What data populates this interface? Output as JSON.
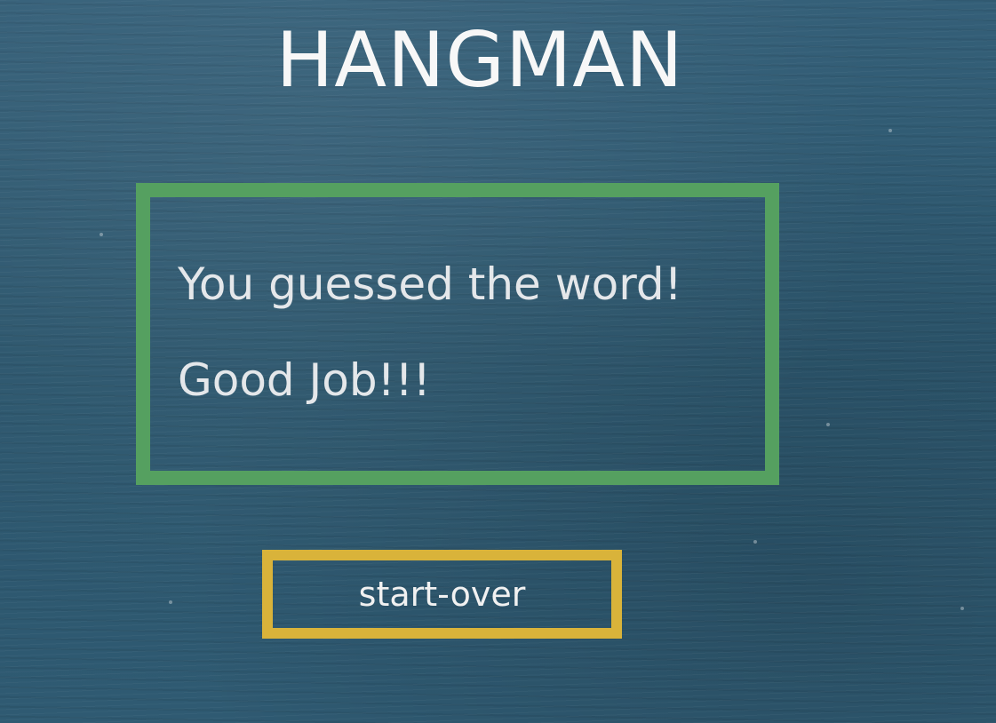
{
  "game": {
    "title": "HANGMAN"
  },
  "result": {
    "line1": "You guessed the word!",
    "line2": "Good Job!!!"
  },
  "controls": {
    "start_over_label": "start-over"
  },
  "colors": {
    "background": "#2f5a72",
    "result_border": "#55a060",
    "button_border": "#d9b33a",
    "text": "#e4e7ea"
  }
}
